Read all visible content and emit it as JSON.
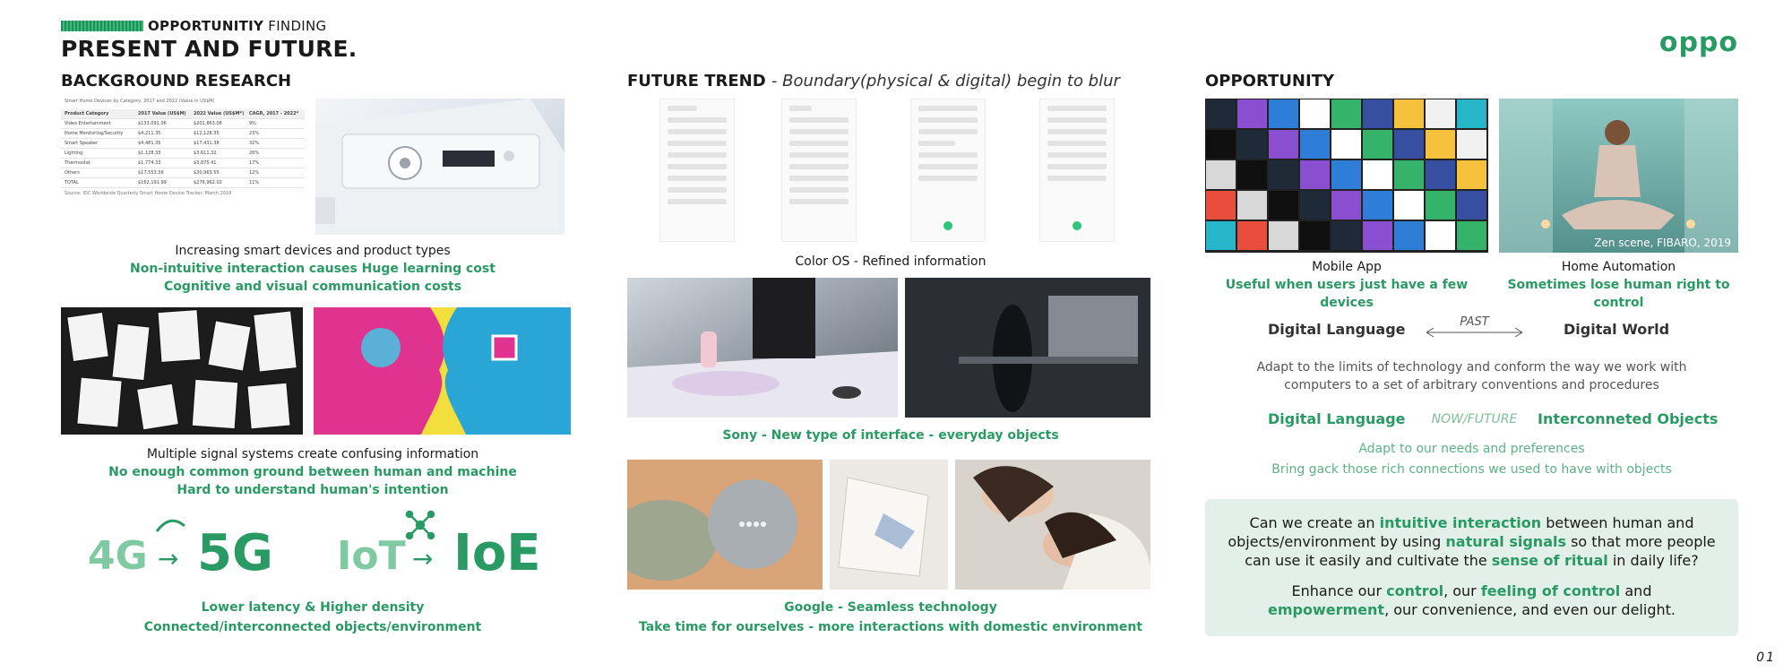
{
  "header": {
    "tag_bold": "OPPORTUNITIY",
    "tag_rest": " FINDING",
    "title": "PRESENT AND FUTURE.",
    "logo": "oppo"
  },
  "left": {
    "title": "BACKGROUND RESEARCH",
    "table": {
      "caption": "Smart Home Devices by Category, 2017 and 2022 (Value in US$M)",
      "headers": [
        "Product Category",
        "2017 Value (US$M)",
        "2022 Value (US$M*)",
        "CAGR, 2017 - 2022*"
      ],
      "rows": [
        [
          "Video Entertainment",
          "$133,091.06",
          "$201,863.08",
          "9%"
        ],
        [
          "Home Monitoring/Security",
          "$4,211.35",
          "$12,128.35",
          "23%"
        ],
        [
          "Smart Speaker",
          "$4,481.35",
          "$17,431.38",
          "32%"
        ],
        [
          "Lighting",
          "$1,128.33",
          "$3,611.32",
          "26%"
        ],
        [
          "Thermostat",
          "$1,774.33",
          "$3,875.41",
          "17%"
        ],
        [
          "Others",
          "$17,553.56",
          "$30,963.55",
          "12%"
        ],
        [
          "TOTAL",
          "$162,191.99",
          "$276,962.02",
          "11%"
        ]
      ],
      "source": "Source: IDC Worldwide Quarterly Smart Home Device Tracker, March 2018"
    },
    "cap1": [
      "Increasing smart devices and product types",
      "Non-intuitive interaction causes Huge learning cost",
      "Cognitive and visual communication costs"
    ],
    "cap2": [
      "Multiple signal systems create confusing information",
      "No enough common ground between human and machine",
      "Hard to understand human's intention"
    ],
    "tech": {
      "a": "4G",
      "b": "5G",
      "c": "IoT",
      "d": "IoE",
      "arrow": "→"
    },
    "cap3": [
      "Lower latency & Higher density",
      "Connected/interconnected objects/environment"
    ]
  },
  "middle": {
    "title": "FUTURE TREND",
    "subtitle": "- Boundary(physical & digital) begin to blur",
    "cap1": "Color OS - Refined information",
    "cap2": "Sony - New type of interface - everyday objects",
    "cap3": [
      "Google - Seamless technology",
      "Take time for ourselves - more interactions with domestic environment"
    ]
  },
  "right": {
    "title": "OPPORTUNITY",
    "img1_label": "Mobile App",
    "img1_note": "Useful when users just have a few devices",
    "img2_label": "Home Automation",
    "img2_note": "Sometimes lose human right to control",
    "img2_credit": "Zen scene, FIBARO, 2019",
    "past_left": "Digital Language",
    "past_mid": "PAST",
    "past_right": "Digital World",
    "past_desc": [
      "Adapt to the limits of technology and conform the way we work with",
      "computers to a set of arbitrary conventions and procedures"
    ],
    "now_left": "Digital Language",
    "now_mid": "NOW/FUTURE",
    "now_right": "Interconneted Objects",
    "now_desc": [
      "Adapt to our needs and preferences",
      "Bring gack those rich connections we used to have with objects"
    ],
    "conclusion": {
      "p1": [
        "Can we create an ",
        "intuitive interaction",
        " between human and",
        "objects/environment by using ",
        "natural signals",
        " so that more people",
        "can use it easily and cultivate the ",
        "sense of ritual",
        " in daily life?"
      ],
      "p2": [
        "Enhance our ",
        "control",
        ", our ",
        "feeling of control",
        " and",
        "empowerment",
        ", our convenience, and even our delight."
      ]
    }
  },
  "page_number": "01",
  "colors": {
    "accent": "#2a9a64",
    "conclusion_bg": "#e3efe9"
  }
}
